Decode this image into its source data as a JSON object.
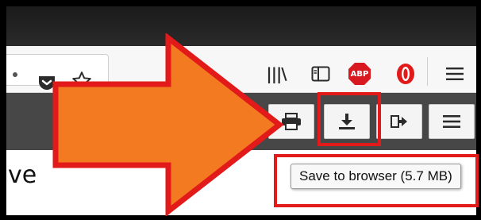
{
  "browser_toolbar": {
    "icons": [
      "pocket-icon",
      "bookmark-star-icon",
      "library-icon",
      "sidebar-icon",
      "adblock-plus-icon",
      "opera-icon",
      "hamburger-menu-icon"
    ],
    "abp_badge": "ABP",
    "library_glyph": "|||\\"
  },
  "pdf_toolbar": {
    "icons": [
      "print-icon",
      "download-icon",
      "presentation-mode-icon",
      "tools-menu-icon"
    ]
  },
  "page": {
    "visible_text": "ve"
  },
  "tooltip": {
    "text": "Save to browser (5.7 MB)"
  },
  "colors": {
    "arrow_fill": "#f47a22",
    "highlight": "#e21a1a",
    "abp_red": "#d8191f",
    "opera_red": "#e21a1a",
    "pdf_toolbar_bg": "#474747"
  }
}
